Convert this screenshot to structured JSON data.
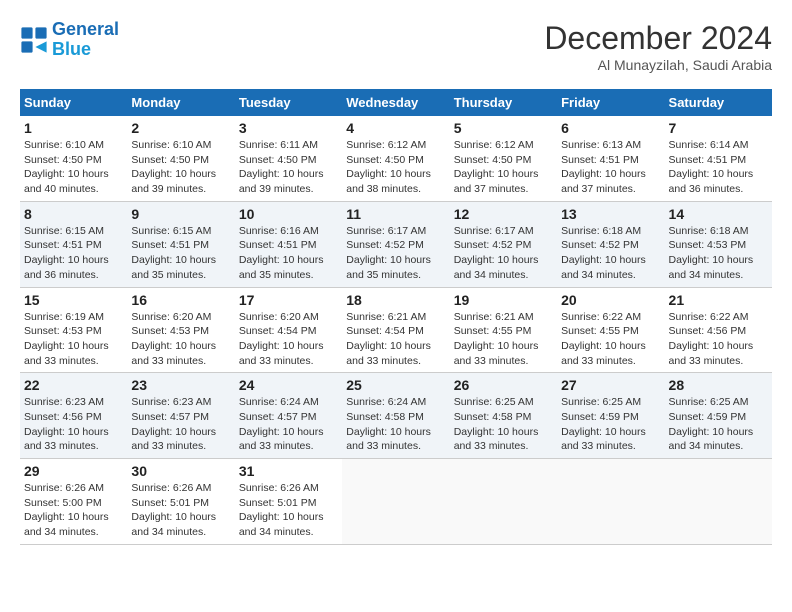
{
  "header": {
    "logo_line1": "General",
    "logo_line2": "Blue",
    "month": "December 2024",
    "location": "Al Munayzilah, Saudi Arabia"
  },
  "weekdays": [
    "Sunday",
    "Monday",
    "Tuesday",
    "Wednesday",
    "Thursday",
    "Friday",
    "Saturday"
  ],
  "weeks": [
    [
      {
        "day": "1",
        "sunrise": "6:10 AM",
        "sunset": "4:50 PM",
        "daylight": "10 hours and 40 minutes."
      },
      {
        "day": "2",
        "sunrise": "6:10 AM",
        "sunset": "4:50 PM",
        "daylight": "10 hours and 39 minutes."
      },
      {
        "day": "3",
        "sunrise": "6:11 AM",
        "sunset": "4:50 PM",
        "daylight": "10 hours and 39 minutes."
      },
      {
        "day": "4",
        "sunrise": "6:12 AM",
        "sunset": "4:50 PM",
        "daylight": "10 hours and 38 minutes."
      },
      {
        "day": "5",
        "sunrise": "6:12 AM",
        "sunset": "4:50 PM",
        "daylight": "10 hours and 37 minutes."
      },
      {
        "day": "6",
        "sunrise": "6:13 AM",
        "sunset": "4:51 PM",
        "daylight": "10 hours and 37 minutes."
      },
      {
        "day": "7",
        "sunrise": "6:14 AM",
        "sunset": "4:51 PM",
        "daylight": "10 hours and 36 minutes."
      }
    ],
    [
      {
        "day": "8",
        "sunrise": "6:15 AM",
        "sunset": "4:51 PM",
        "daylight": "10 hours and 36 minutes."
      },
      {
        "day": "9",
        "sunrise": "6:15 AM",
        "sunset": "4:51 PM",
        "daylight": "10 hours and 35 minutes."
      },
      {
        "day": "10",
        "sunrise": "6:16 AM",
        "sunset": "4:51 PM",
        "daylight": "10 hours and 35 minutes."
      },
      {
        "day": "11",
        "sunrise": "6:17 AM",
        "sunset": "4:52 PM",
        "daylight": "10 hours and 35 minutes."
      },
      {
        "day": "12",
        "sunrise": "6:17 AM",
        "sunset": "4:52 PM",
        "daylight": "10 hours and 34 minutes."
      },
      {
        "day": "13",
        "sunrise": "6:18 AM",
        "sunset": "4:52 PM",
        "daylight": "10 hours and 34 minutes."
      },
      {
        "day": "14",
        "sunrise": "6:18 AM",
        "sunset": "4:53 PM",
        "daylight": "10 hours and 34 minutes."
      }
    ],
    [
      {
        "day": "15",
        "sunrise": "6:19 AM",
        "sunset": "4:53 PM",
        "daylight": "10 hours and 33 minutes."
      },
      {
        "day": "16",
        "sunrise": "6:20 AM",
        "sunset": "4:53 PM",
        "daylight": "10 hours and 33 minutes."
      },
      {
        "day": "17",
        "sunrise": "6:20 AM",
        "sunset": "4:54 PM",
        "daylight": "10 hours and 33 minutes."
      },
      {
        "day": "18",
        "sunrise": "6:21 AM",
        "sunset": "4:54 PM",
        "daylight": "10 hours and 33 minutes."
      },
      {
        "day": "19",
        "sunrise": "6:21 AM",
        "sunset": "4:55 PM",
        "daylight": "10 hours and 33 minutes."
      },
      {
        "day": "20",
        "sunrise": "6:22 AM",
        "sunset": "4:55 PM",
        "daylight": "10 hours and 33 minutes."
      },
      {
        "day": "21",
        "sunrise": "6:22 AM",
        "sunset": "4:56 PM",
        "daylight": "10 hours and 33 minutes."
      }
    ],
    [
      {
        "day": "22",
        "sunrise": "6:23 AM",
        "sunset": "4:56 PM",
        "daylight": "10 hours and 33 minutes."
      },
      {
        "day": "23",
        "sunrise": "6:23 AM",
        "sunset": "4:57 PM",
        "daylight": "10 hours and 33 minutes."
      },
      {
        "day": "24",
        "sunrise": "6:24 AM",
        "sunset": "4:57 PM",
        "daylight": "10 hours and 33 minutes."
      },
      {
        "day": "25",
        "sunrise": "6:24 AM",
        "sunset": "4:58 PM",
        "daylight": "10 hours and 33 minutes."
      },
      {
        "day": "26",
        "sunrise": "6:25 AM",
        "sunset": "4:58 PM",
        "daylight": "10 hours and 33 minutes."
      },
      {
        "day": "27",
        "sunrise": "6:25 AM",
        "sunset": "4:59 PM",
        "daylight": "10 hours and 33 minutes."
      },
      {
        "day": "28",
        "sunrise": "6:25 AM",
        "sunset": "4:59 PM",
        "daylight": "10 hours and 34 minutes."
      }
    ],
    [
      {
        "day": "29",
        "sunrise": "6:26 AM",
        "sunset": "5:00 PM",
        "daylight": "10 hours and 34 minutes."
      },
      {
        "day": "30",
        "sunrise": "6:26 AM",
        "sunset": "5:01 PM",
        "daylight": "10 hours and 34 minutes."
      },
      {
        "day": "31",
        "sunrise": "6:26 AM",
        "sunset": "5:01 PM",
        "daylight": "10 hours and 34 minutes."
      },
      null,
      null,
      null,
      null
    ]
  ],
  "labels": {
    "sunrise_prefix": "Sunrise: ",
    "sunset_prefix": "Sunset: ",
    "daylight_prefix": "Daylight: "
  }
}
